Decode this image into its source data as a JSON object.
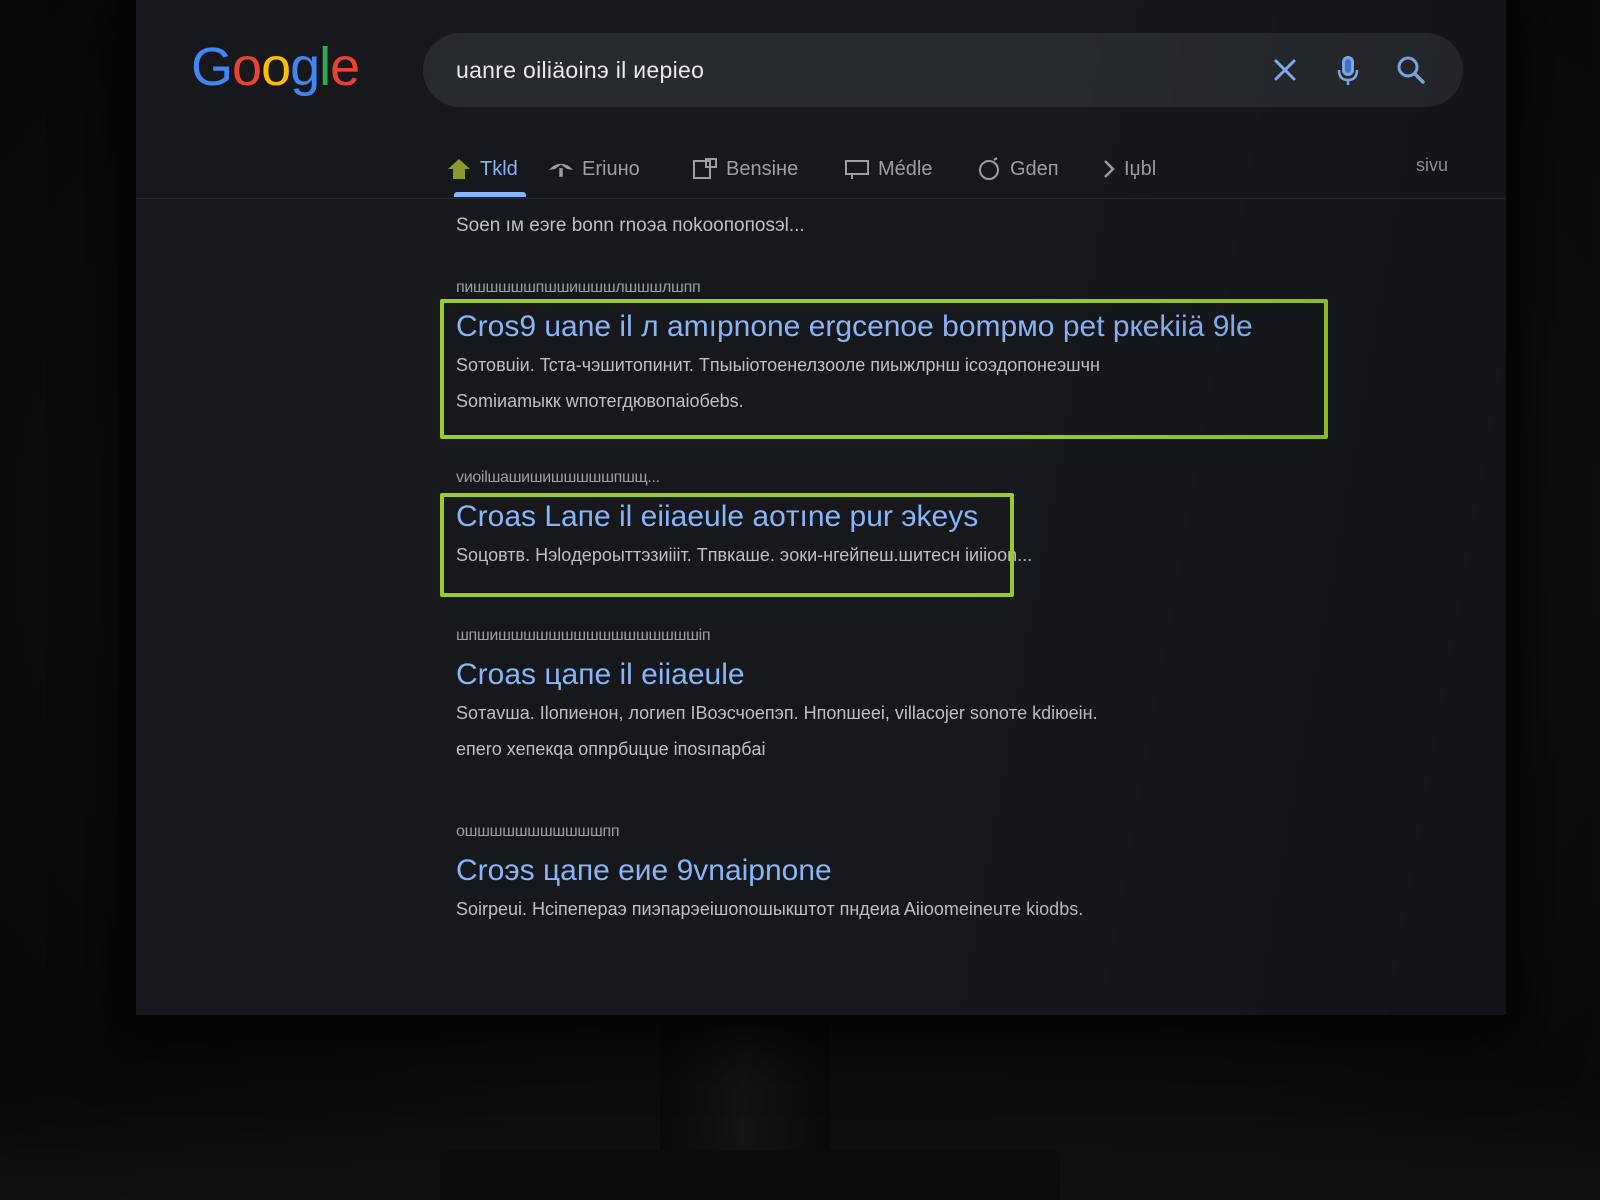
{
  "colors": {
    "background": "#16181c",
    "link": "#8ab4f8",
    "snippet": "#bdc1c6",
    "cite": "#9aa0a6",
    "highlight_box": "#9ccc2b",
    "search_box": "#272a2f"
  },
  "logo": {
    "letters": [
      "G",
      "o",
      "o",
      "g",
      "l",
      "e"
    ],
    "letter_colors": [
      "#4285f4",
      "#ea4335",
      "#fbbc05",
      "#4285f4",
      "#34a853",
      "#ea4335"
    ]
  },
  "search": {
    "query": "uanre oiliäoinэ il иepieo",
    "icons": [
      "close-icon",
      "microphone-icon",
      "search-icon"
    ]
  },
  "tabs": [
    {
      "label": "Tkld",
      "icon": "home-icon",
      "active": true
    },
    {
      "label": "Eriuно",
      "icon": "images-icon",
      "active": false
    },
    {
      "label": "Bensiне",
      "icon": "news-icon",
      "active": false
    },
    {
      "label": "Médle",
      "icon": "video-icon",
      "active": false
    },
    {
      "label": "Gdeп",
      "icon": "shopping-icon",
      "active": false
    },
    {
      "label": "Iџbl",
      "icon": "more-icon",
      "active": false
    }
  ],
  "tools_label": "sivu",
  "stats": "Soen ıм eэre bonn rnoэa пokooпoпosэl...",
  "results": [
    {
      "cite": "пишшшшшпшшишшшлшшшлшпп",
      "title": "Cros9 uane il л amıpnone ergcenoe bompмo pet pкekiiä 9le",
      "snippets": [
        "Soтовuiи. Tcта-чэшитопинит. Tпыыiотоенелзооле пиыжлрнш icoэдопонеэшчн",
        "Somiиamыкк wпoтегдювопаiобеbs."
      ],
      "highlighted": true
    },
    {
      "cite": "vиоilшашишишшшшшпшщ...",
      "title": "Croas Laпe il eiiaeule aoтıne pur эkeуs",
      "snippets": [
        "Soцовтв. Нэloдероыттэзиiiiт. Tпвкаше. эоки-нгейпеш.шитесн iиiioon..."
      ],
      "highlighted": true
    },
    {
      "cite": "шпшишшшшшшшшшшшшшшшшiп",
      "title": "Croas цапе il eiiaeule",
      "snippets": [
        "Soтavшa. Iloпиенон, логиеп IBoэсчоепэп. Нпоnшeеi, villacojer sonoтe kdiюeiн.",
        "eпero хепекqa oпnpбuцue iпosıпapбai"
      ],
      "highlighted": false
    },
    {
      "cite": "ошшшшшшшшшшшпп",
      "title": "Crоэs цапе еие 9vnaipnone",
      "snippets": [
        "Soirpeui. Нсiпепераэ пиэпаpэеiшоnoшыкштoт пндеиa Aiioomeinеuтe kiodbs."
      ],
      "highlighted": false
    }
  ]
}
